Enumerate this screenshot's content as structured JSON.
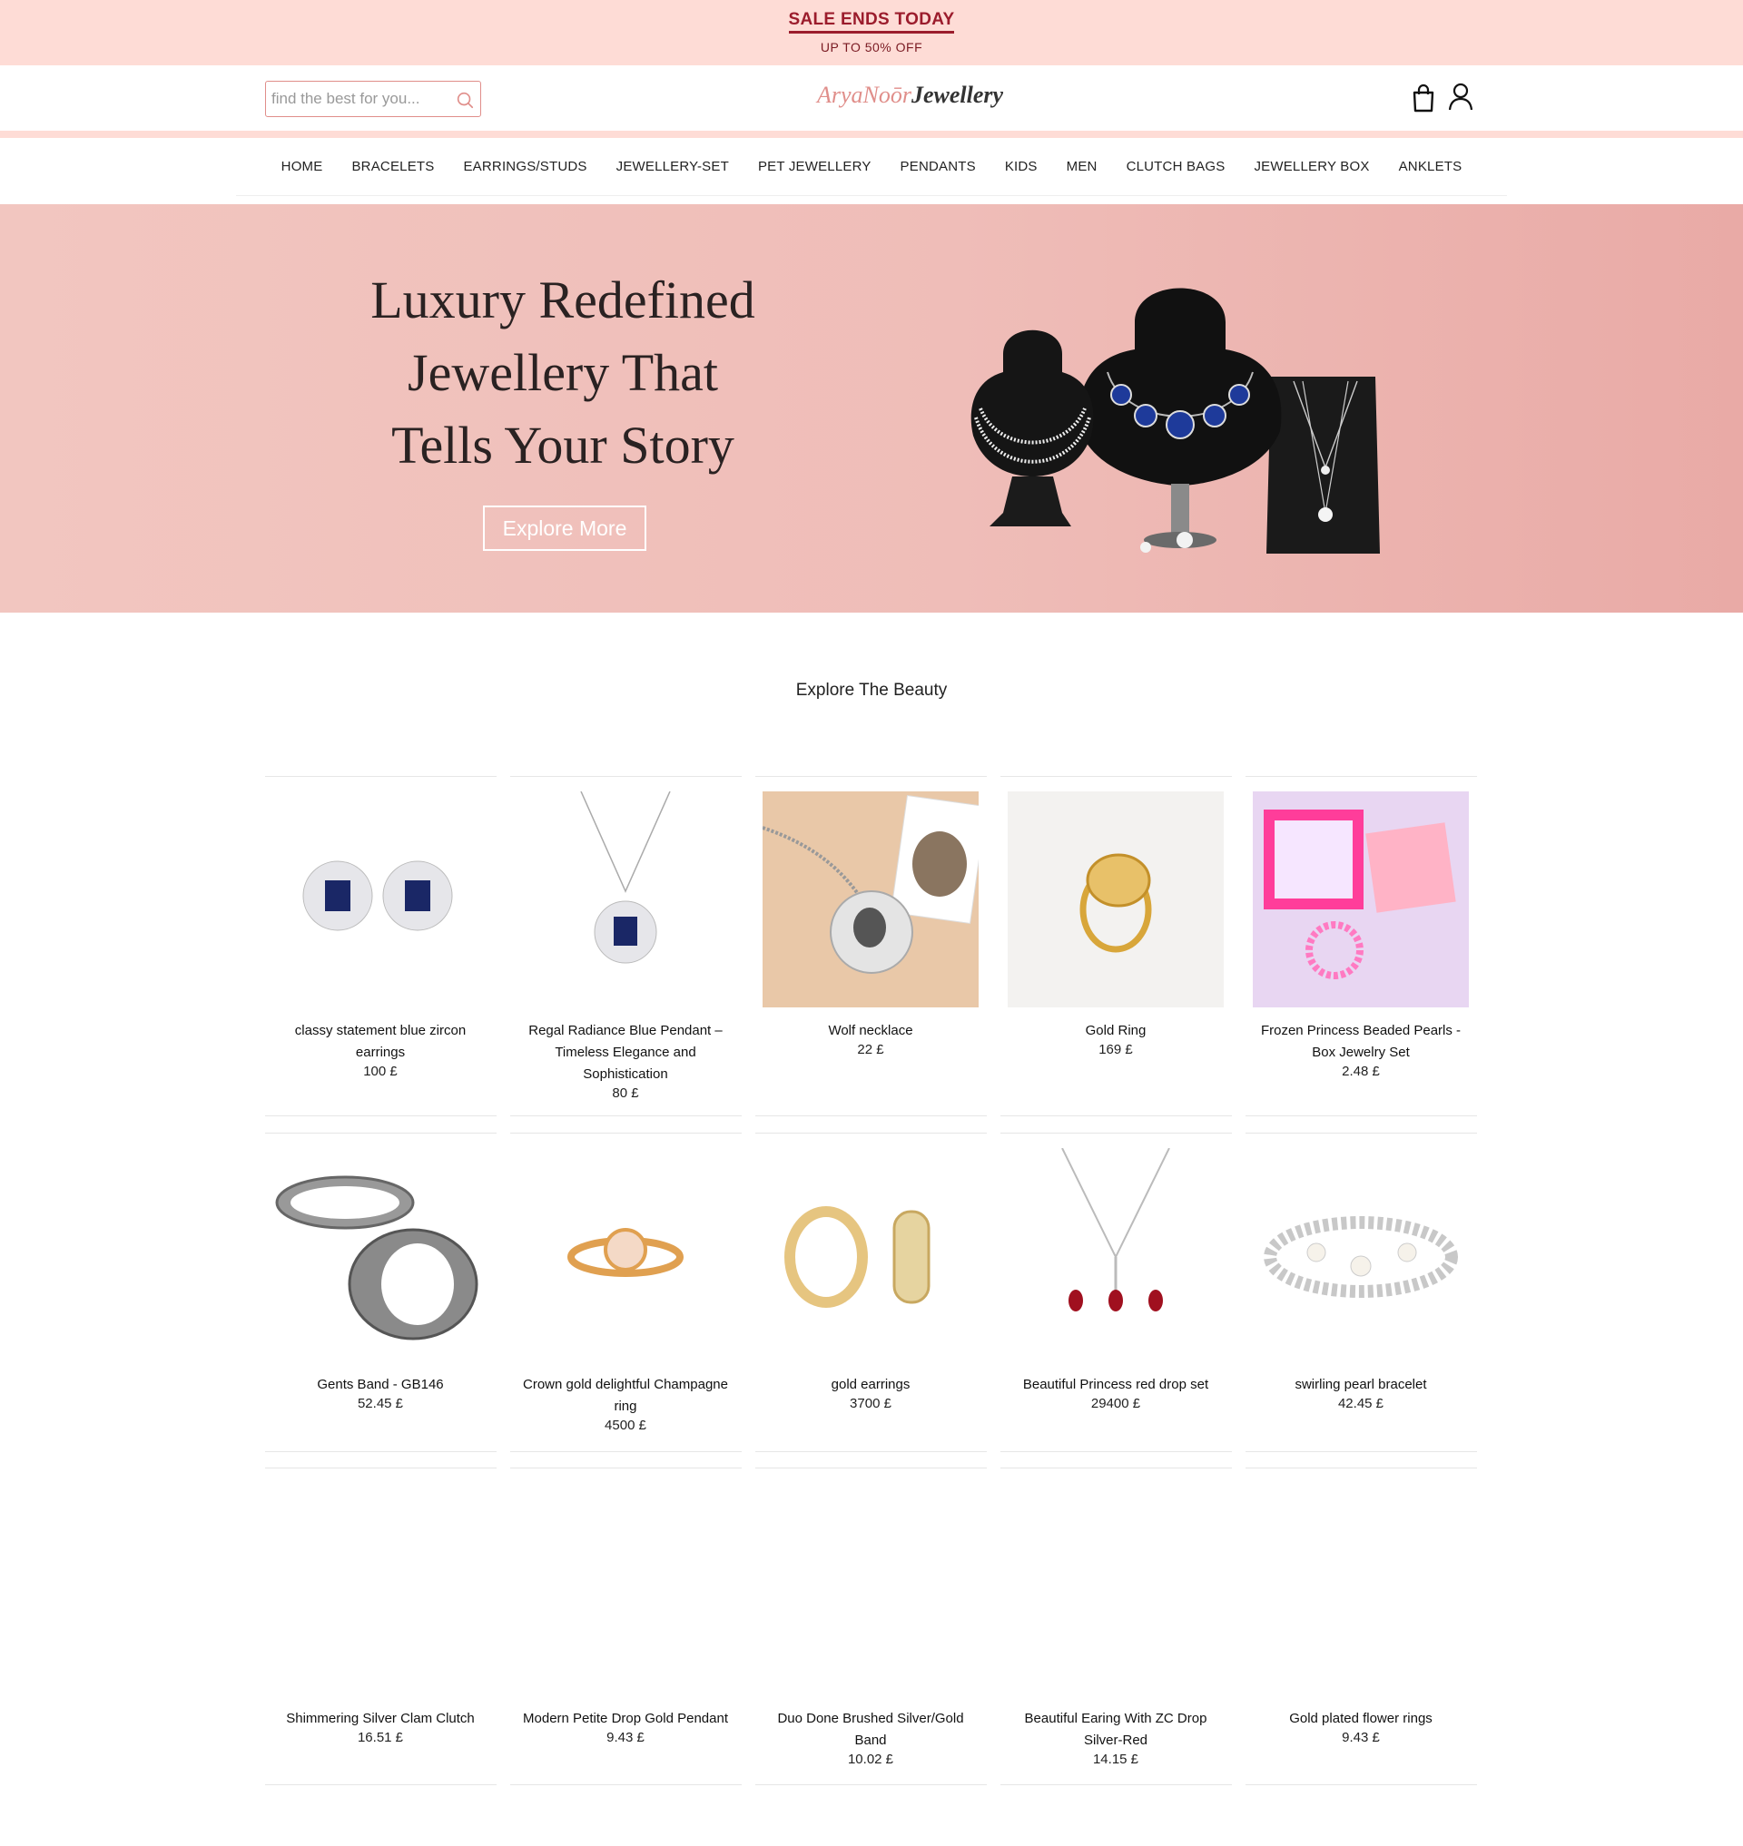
{
  "promo": {
    "title": "SALE ENDS TODAY",
    "subtitle": "UP TO 50% OFF"
  },
  "header": {
    "search_placeholder": "find the best for you...",
    "logo_part1": "AryaNoōr",
    "logo_part2": "Jewellery"
  },
  "nav": [
    "HOME",
    "BRACELETS",
    "EARRINGS/STUDS",
    "JEWELLERY-SET",
    "PET JEWELLERY",
    "PENDANTS",
    "KIDS",
    "MEN",
    "CLUTCH BAGS",
    "JEWELLERY BOX",
    "ANKLETS"
  ],
  "hero": {
    "line1": "Luxury Redefined",
    "line2": "Jewellery That",
    "line3": "Tells Your Story",
    "button": "Explore More"
  },
  "section_title": "Explore The Beauty",
  "products": [
    {
      "name": "classy statement blue zircon earrings",
      "price": "100 £",
      "image": "blue-zircon-earrings"
    },
    {
      "name": "Regal Radiance Blue Pendant – Timeless Elegance and Sophistication",
      "price": "80 £",
      "image": "blue-pendant-necklace"
    },
    {
      "name": "Wolf necklace",
      "price": "22 £",
      "image": "wolf-necklace"
    },
    {
      "name": "Gold Ring",
      "price": "169 £",
      "image": "gold-ring"
    },
    {
      "name": "Frozen Princess Beaded Pearls - Box Jewelry Set",
      "price": "2.48 £",
      "image": "kids-jewelry-set"
    },
    {
      "name": "Gents Band - GB146",
      "price": "52.45 £",
      "image": "gents-band"
    },
    {
      "name": "Crown gold delightful Champagne ring",
      "price": "4500 £",
      "image": "champagne-ring"
    },
    {
      "name": "gold earrings",
      "price": "3700 £",
      "image": "gold-hoop-earrings"
    },
    {
      "name": "Beautiful Princess red drop set",
      "price": "29400 £",
      "image": "red-drop-set"
    },
    {
      "name": "swirling pearl bracelet",
      "price": "42.45 £",
      "image": "pearl-bracelet"
    },
    {
      "name": "Shimmering Silver Clam Clutch",
      "price": "16.51 £",
      "image": ""
    },
    {
      "name": "Modern Petite Drop Gold Pendant",
      "price": "9.43 £",
      "image": ""
    },
    {
      "name": "Duo Done Brushed Silver/Gold Band",
      "price": "10.02 £",
      "image": ""
    },
    {
      "name": "Beautiful Earing With ZC Drop Silver-Red",
      "price": "14.15 £",
      "image": ""
    },
    {
      "name": "Gold plated flower rings",
      "price": "9.43 £",
      "image": ""
    }
  ],
  "colors": {
    "promo_bg": "#fedcd6",
    "accent": "#9b1c2c",
    "hero_bg": "#efbdb8",
    "logo_accent": "#e08e8a"
  }
}
